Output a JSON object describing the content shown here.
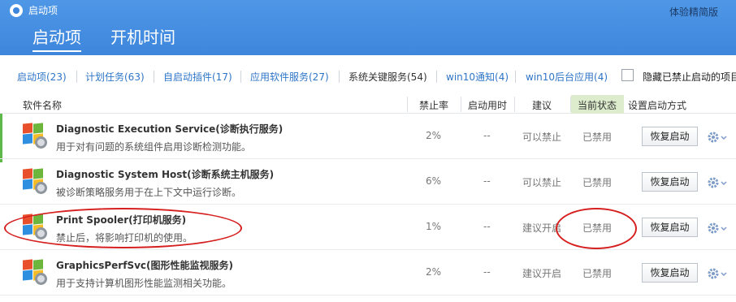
{
  "window": {
    "title": "启动项",
    "edition": "体验精简版"
  },
  "main_tabs": [
    {
      "label": "启动项",
      "active": true
    },
    {
      "label": "开机时间",
      "active": false
    }
  ],
  "sub_tabs": [
    {
      "label": "启动项(23)"
    },
    {
      "label": "计划任务(63)"
    },
    {
      "label": "自启动插件(17)"
    },
    {
      "label": "应用软件服务(27)"
    },
    {
      "label": "系统关键服务(54)",
      "active": true
    },
    {
      "label": "win10通知(4)"
    },
    {
      "label": "win10后台应用(4)"
    }
  ],
  "hide_disabled_label": "隐藏已禁止启动的项目",
  "columns": {
    "name": "软件名称",
    "disable_rate": "禁止率",
    "startup_time": "启动用时",
    "suggestion": "建议",
    "status": "当前状态",
    "set_mode": "设置启动方式"
  },
  "rows": [
    {
      "name": "Diagnostic Execution Service(诊断执行服务)",
      "desc": "用于对有问题的系统组件启用诊断检测功能。",
      "rate": "2%",
      "time": "--",
      "suggestion": "可以禁止",
      "status": "已禁用",
      "action": "恢复启动"
    },
    {
      "name": "Diagnostic System Host(诊断系统主机服务)",
      "desc": "被诊断策略服务用于在上下文中运行诊断。",
      "rate": "6%",
      "time": "--",
      "suggestion": "可以禁止",
      "status": "已禁用",
      "action": "恢复启动"
    },
    {
      "name": "Print Spooler(打印机服务)",
      "desc": "禁止后，将影响打印机的使用。",
      "rate": "1%",
      "time": "--",
      "suggestion": "建议开启",
      "status": "已禁用",
      "action": "恢复启动"
    },
    {
      "name": "GraphicsPerfSvc(图形性能监视服务)",
      "desc": "用于支持计算机图形性能监测相关功能。",
      "rate": "2%",
      "time": "--",
      "suggestion": "建议开启",
      "status": "已禁用",
      "action": "恢复启动"
    }
  ],
  "colors": {
    "header": "#3d86dc",
    "link": "#2f76c7",
    "annotation": "#d61f1f",
    "status_header_bg": "#ddeccd"
  },
  "icons": {
    "app": "tencent-logo-icon",
    "service": "windows-service-icon",
    "settings": "gear-dropdown-icon"
  }
}
